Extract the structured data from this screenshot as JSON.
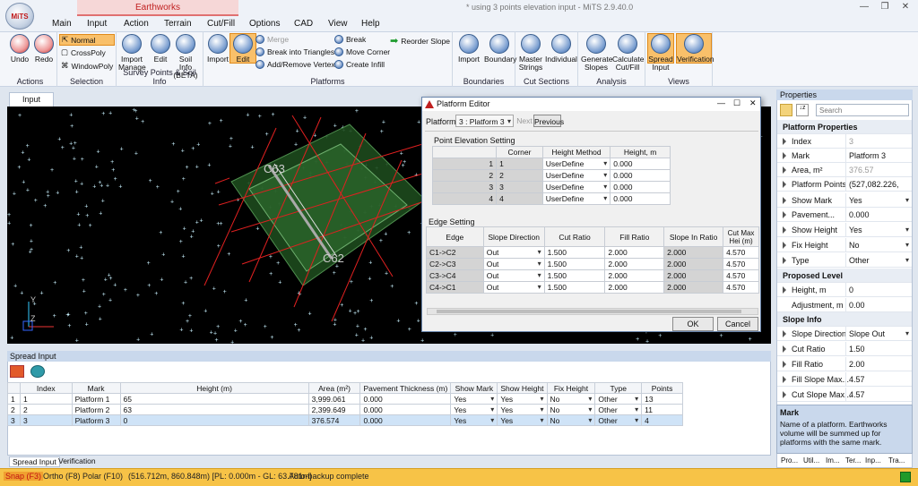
{
  "window": {
    "title": "* using 3 points elevation input - MiTS 2.9.40.0",
    "context_tab": "Earthworks"
  },
  "ribbon_tabs": [
    "Main",
    "Input",
    "Action",
    "Terrain",
    "Cut/Fill",
    "Options",
    "CAD",
    "View",
    "Help"
  ],
  "groups": {
    "actions": {
      "label": "Actions",
      "undo": "Undo",
      "redo": "Redo"
    },
    "selection": {
      "label": "Selection",
      "normal": "Normal",
      "crosspoly": "CrossPoly",
      "windowpoly": "WindowPoly"
    },
    "survey": {
      "label": "Survey Points & Soil Info",
      "import_manage": "Import Manage",
      "edit": "Edit",
      "soil_info": "Soil Info (BETA)"
    },
    "platforms": {
      "label": "Platforms",
      "import": "Import",
      "edit": "Edit",
      "merge": "Merge",
      "break_tri": "Break into Triangles",
      "add_remove": "Add/Remove Vertex",
      "break": "Break",
      "move_corner": "Move Corner",
      "create_infill": "Create Infill",
      "reorder": "Reorder Slope"
    },
    "boundaries": {
      "label": "Boundaries",
      "import": "Import",
      "boundary": "Boundary"
    },
    "cut_sections": {
      "label": "Cut Sections",
      "master": "Master Strings",
      "individual": "Individual"
    },
    "analysis": {
      "label": "Analysis",
      "generate": "Generate Slopes",
      "calculate": "Calculate Cut/Fill"
    },
    "views": {
      "label": "Views",
      "spread": "Spread Input",
      "verification": "Verification"
    }
  },
  "doc_tab": "Input",
  "canvas": {
    "labels": [
      "C63",
      "C62"
    ],
    "axis_y": "Y",
    "axis_z": "Z"
  },
  "spread": {
    "title": "Spread Input",
    "columns": [
      "Index",
      "Mark",
      "Height (m)",
      "Area (m²)",
      "Pavement Thickness (m)",
      "Show Mark",
      "Show Height",
      "Fix Height",
      "Type",
      "Points"
    ],
    "rows": [
      {
        "n": "1",
        "index": "1",
        "mark": "Platform 1",
        "height": "65",
        "area": "3,999.061",
        "pave": "0.000",
        "show_mark": "Yes",
        "show_height": "Yes",
        "fix": "No",
        "type": "Other",
        "points": "13"
      },
      {
        "n": "2",
        "index": "2",
        "mark": "Platform 2",
        "height": "63",
        "area": "2,399.649",
        "pave": "0.000",
        "show_mark": "Yes",
        "show_height": "Yes",
        "fix": "No",
        "type": "Other",
        "points": "11"
      },
      {
        "n": "3",
        "index": "3",
        "mark": "Platform 3",
        "height": "0",
        "area": "376.574",
        "pave": "0.000",
        "show_mark": "Yes",
        "show_height": "Yes",
        "fix": "No",
        "type": "Other",
        "points": "4"
      }
    ]
  },
  "bottom_tabs": [
    "Spread Input",
    "Verification"
  ],
  "status": {
    "snap": "Snap (F3)",
    "ortho": "Ortho (F8)",
    "polar": "Polar (F10)",
    "coords": "(516.712m, 860.848m) [PL: 0.000m - GL: 63.781m]",
    "message": "Auto-backup complete"
  },
  "properties": {
    "title": "Properties",
    "search_placeholder": "Search",
    "sections": {
      "platform": "Platform Properties",
      "proposed": "Proposed Level",
      "slope": "Slope Info"
    },
    "rows": {
      "index": {
        "name": "Index",
        "value": "3"
      },
      "mark": {
        "name": "Mark",
        "value": "Platform 3"
      },
      "area": {
        "name": "Area, m²",
        "value": "376.57"
      },
      "points": {
        "name": "Platform Points",
        "value": "(527,082.226, 8"
      },
      "show_mark": {
        "name": "Show Mark",
        "value": "Yes"
      },
      "pavement": {
        "name": "Pavement...",
        "value": "0.000"
      },
      "show_height": {
        "name": "Show Height",
        "value": "Yes"
      },
      "fix_height": {
        "name": "Fix Height",
        "value": "No"
      },
      "type": {
        "name": "Type",
        "value": "Other"
      },
      "height": {
        "name": "Height, m",
        "value": "0"
      },
      "adjustment": {
        "name": "Adjustment, m",
        "value": "0.00"
      },
      "slope_dir": {
        "name": "Slope Direction",
        "value": "Slope Out"
      },
      "cut_ratio": {
        "name": "Cut Ratio",
        "value": "1.50"
      },
      "fill_ratio": {
        "name": "Fill Ratio",
        "value": "2.00"
      },
      "fill_slope": {
        "name": "Fill Slope Max...",
        "value": "4.57"
      },
      "cut_slope": {
        "name": "Cut Slope Max...",
        "value": "4.57"
      }
    },
    "desc_title": "Mark",
    "desc_text": "Name of a platform. Earthworks volume will be summed up for platforms with the same mark.",
    "bottom_tabs": [
      "Pro...",
      "Util...",
      "Im...",
      "Ter...",
      "Inp...",
      "Tra..."
    ]
  },
  "dialog": {
    "title": "Platform Editor",
    "platform_label": "Platform",
    "platform_value": "3 : Platform 3",
    "next": "Next",
    "previous": "Previous",
    "point_section": "Point Elevation Setting",
    "point_headers": [
      "Corner",
      "Height Method",
      "Height, m"
    ],
    "points": [
      {
        "n": "1",
        "corner": "1",
        "method": "UserDefine",
        "height": "0.000"
      },
      {
        "n": "2",
        "corner": "2",
        "method": "UserDefine",
        "height": "0.000"
      },
      {
        "n": "3",
        "corner": "3",
        "method": "UserDefine",
        "height": "0.000"
      },
      {
        "n": "4",
        "corner": "4",
        "method": "UserDefine",
        "height": "0.000"
      }
    ],
    "edge_section": "Edge Setting",
    "edge_headers": [
      "Edge",
      "Slope Direction",
      "Cut Ratio",
      "Fill Ratio",
      "Slope In Ratio",
      "Cut Max Hei (m)"
    ],
    "edges": [
      {
        "edge": "C1->C2",
        "dir": "Out",
        "cut": "1.500",
        "fill": "2.000",
        "slope_in": "2.000",
        "cutmax": "4.570"
      },
      {
        "edge": "C2->C3",
        "dir": "Out",
        "cut": "1.500",
        "fill": "2.000",
        "slope_in": "2.000",
        "cutmax": "4.570"
      },
      {
        "edge": "C3->C4",
        "dir": "Out",
        "cut": "1.500",
        "fill": "2.000",
        "slope_in": "2.000",
        "cutmax": "4.570"
      },
      {
        "edge": "C4->C1",
        "dir": "Out",
        "cut": "1.500",
        "fill": "2.000",
        "slope_in": "2.000",
        "cutmax": "4.570"
      }
    ],
    "ok": "OK",
    "cancel": "Cancel"
  }
}
